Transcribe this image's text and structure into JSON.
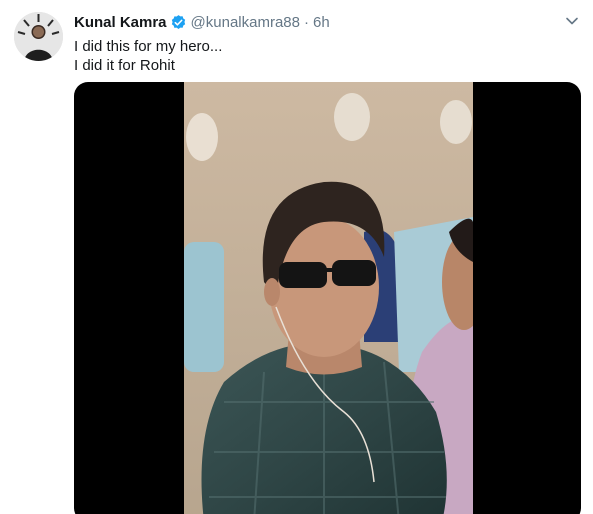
{
  "tweet": {
    "display_name": "Kunal Kamra",
    "handle": "@kunalkamra88",
    "separator": "·",
    "time": "6h",
    "text_lines": [
      "I did this for my hero...",
      "I did it for Rohit"
    ]
  },
  "icons": {
    "verified": "verified-badge-icon",
    "menu": "chevron-down-icon"
  },
  "colors": {
    "name": "#14171a",
    "secondary": "#657786",
    "verified": "#1da1f2",
    "media_bg": "#000000"
  }
}
